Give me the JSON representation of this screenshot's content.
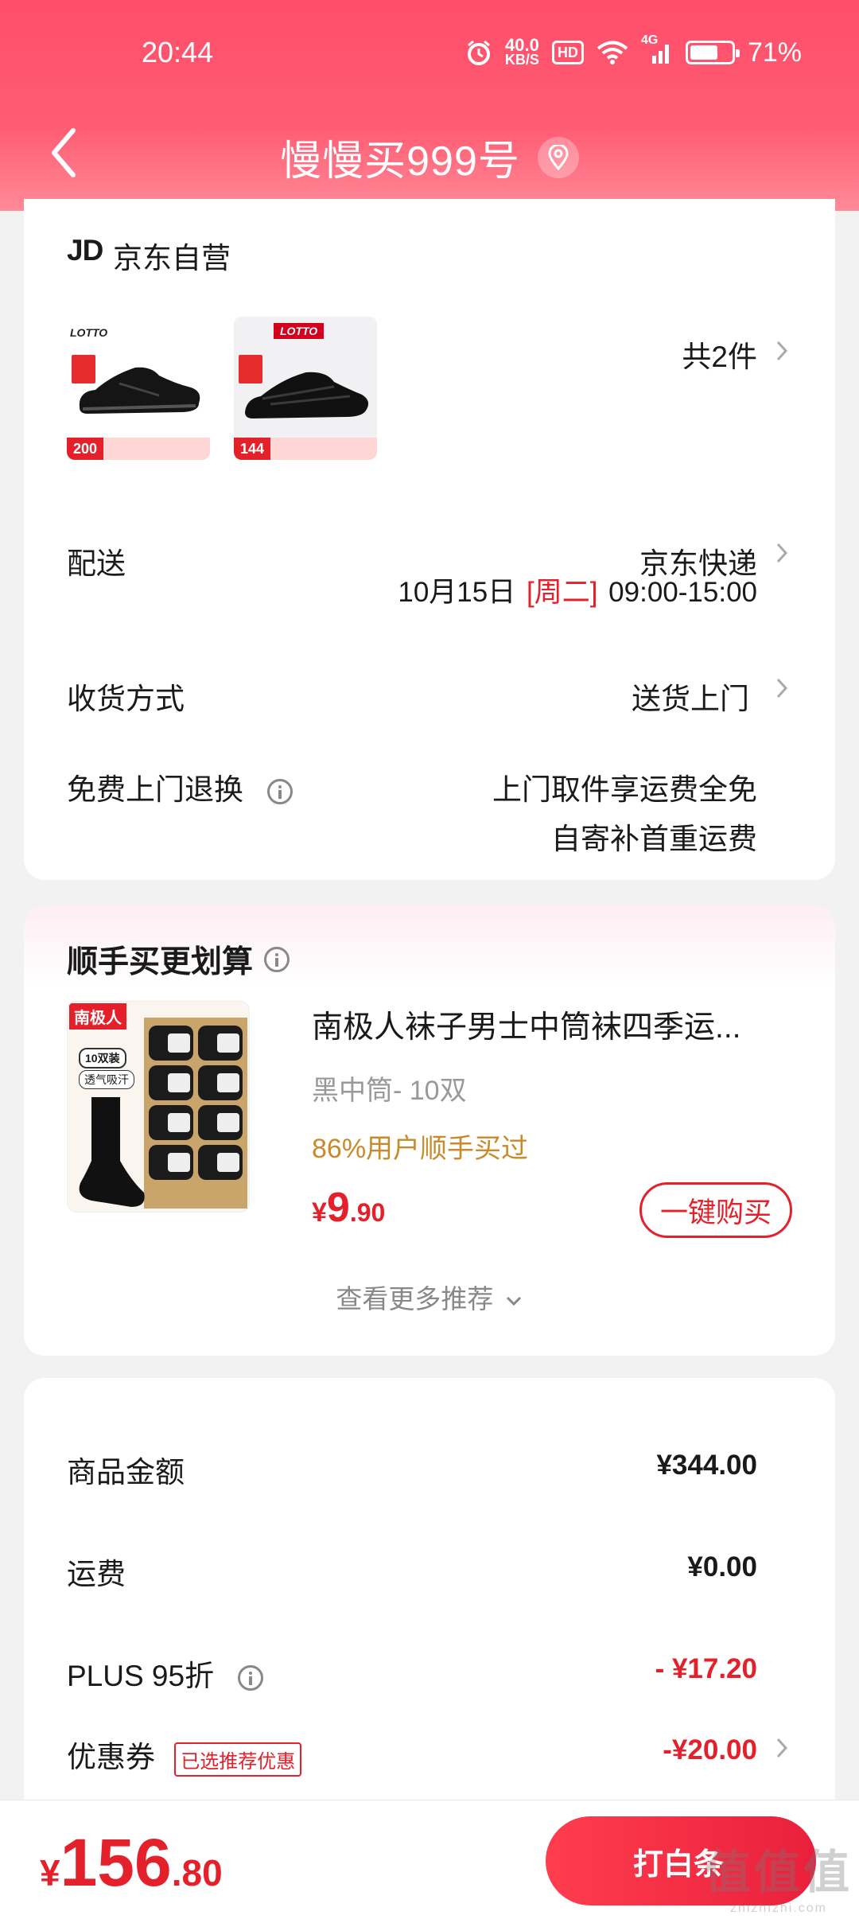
{
  "status": {
    "time": "20:44",
    "speed_value": "40.0",
    "speed_unit": "KB/S",
    "hd": "HD",
    "network": "4G",
    "battery": "71%",
    "battery_level": 0.71
  },
  "nav": {
    "title": "慢慢买999号"
  },
  "order": {
    "store_logo": "JD",
    "store_name": "京东自营",
    "products": [
      {
        "brand": "LOTTO",
        "badge": "200"
      },
      {
        "brand": "LOTTO",
        "badge": "144"
      }
    ],
    "item_count": "共2件",
    "delivery_label": "配送",
    "delivery_value": "京东快递",
    "delivery_date": "10月15日",
    "delivery_weekday": "[周二]",
    "delivery_time": "09:00-15:00",
    "receive_label": "收货方式",
    "receive_value": "送货上门",
    "return_label": "免费上门退换",
    "return_value_1": "上门取件享运费全免",
    "return_value_2": "自寄补首重运费"
  },
  "recommend": {
    "title": "顺手买更划算",
    "img_brand": "南极人",
    "img_pack": "10双装",
    "img_feature": "透气吸汗",
    "name": "南极人袜子男士中筒袜四季运...",
    "spec": "黑中筒- 10双",
    "social_proof": "86%用户顺手买过",
    "price_currency": "¥",
    "price_int": "9",
    "price_dec": ".90",
    "buy_label": "一键购买",
    "more_label": "查看更多推荐"
  },
  "fees": {
    "goods_label": "商品金额",
    "goods_value": "¥344.00",
    "shipping_label": "运费",
    "shipping_value": "¥0.00",
    "plus_label": "PLUS 95折",
    "plus_value": "- ¥17.20",
    "coupon_label": "优惠券",
    "coupon_tag": "已选推荐优惠",
    "coupon_value": "-¥20.00"
  },
  "checkout": {
    "currency": "¥",
    "total_int": "156",
    "total_dec": ".80",
    "pay_label": "打白条"
  },
  "watermark": {
    "big": "值值值",
    "small": "zhizhizhi.com"
  },
  "colors": {
    "brand_red": "#e4202b",
    "header_pink": "#ff4d6a",
    "social_orange": "#c98a2a"
  }
}
